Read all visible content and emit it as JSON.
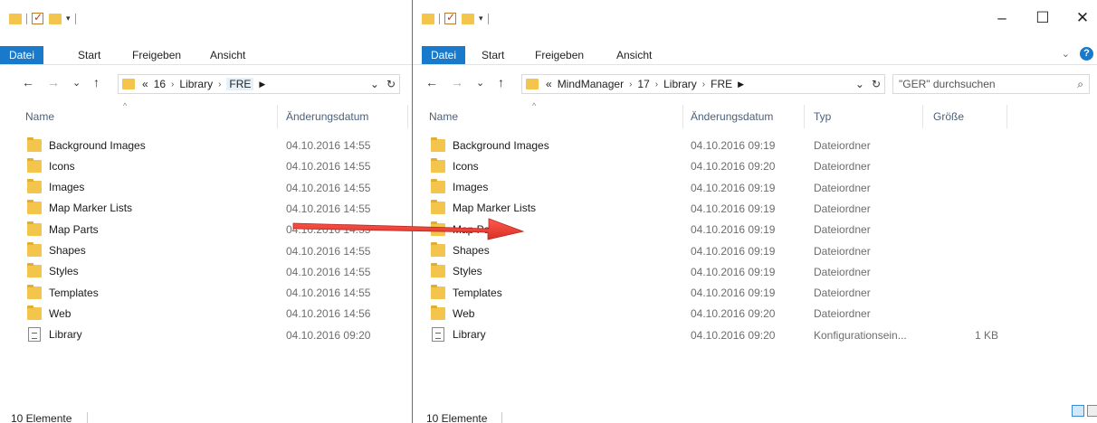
{
  "left": {
    "tabs": [
      "Datei",
      "Start",
      "Freigeben",
      "Ansicht"
    ],
    "breadcrumbs": [
      "«",
      "16",
      "Library",
      "FRE"
    ],
    "columns": [
      "Name",
      "Änderungsdatum"
    ],
    "rows": [
      {
        "name": "Background Images",
        "date": "04.10.2016 14:55"
      },
      {
        "name": "Icons",
        "date": "04.10.2016 14:55"
      },
      {
        "name": "Images",
        "date": "04.10.2016 14:55"
      },
      {
        "name": "Map Marker Lists",
        "date": "04.10.2016 14:55"
      },
      {
        "name": "Map Parts",
        "date": "04.10.2016 14:55"
      },
      {
        "name": "Shapes",
        "date": "04.10.2016 14:55"
      },
      {
        "name": "Styles",
        "date": "04.10.2016 14:55"
      },
      {
        "name": "Templates",
        "date": "04.10.2016 14:55"
      },
      {
        "name": "Web",
        "date": "04.10.2016 14:56"
      },
      {
        "name": "Library",
        "date": "04.10.2016 09:20"
      }
    ],
    "status": "10 Elemente"
  },
  "right": {
    "tabs": [
      "Datei",
      "Start",
      "Freigeben",
      "Ansicht"
    ],
    "breadcrumbs": [
      "«",
      "MindManager",
      "17",
      "Library",
      "FRE"
    ],
    "search_placeholder": "\"GER\" durchsuchen",
    "columns": [
      "Name",
      "Änderungsdatum",
      "Typ",
      "Größe"
    ],
    "rows": [
      {
        "name": "Background Images",
        "date": "04.10.2016 09:19",
        "type": "Dateiordner",
        "size": ""
      },
      {
        "name": "Icons",
        "date": "04.10.2016 09:20",
        "type": "Dateiordner",
        "size": ""
      },
      {
        "name": "Images",
        "date": "04.10.2016 09:19",
        "type": "Dateiordner",
        "size": ""
      },
      {
        "name": "Map Marker Lists",
        "date": "04.10.2016 09:19",
        "type": "Dateiordner",
        "size": ""
      },
      {
        "name": "Map Parts",
        "date": "04.10.2016 09:19",
        "type": "Dateiordner",
        "size": ""
      },
      {
        "name": "Shapes",
        "date": "04.10.2016 09:19",
        "type": "Dateiordner",
        "size": ""
      },
      {
        "name": "Styles",
        "date": "04.10.2016 09:19",
        "type": "Dateiordner",
        "size": ""
      },
      {
        "name": "Templates",
        "date": "04.10.2016 09:19",
        "type": "Dateiordner",
        "size": ""
      },
      {
        "name": "Web",
        "date": "04.10.2016 09:20",
        "type": "Dateiordner",
        "size": ""
      },
      {
        "name": "Library",
        "date": "04.10.2016 09:20",
        "type": "Konfigurationsein...",
        "size": "1 KB"
      }
    ],
    "status": "10 Elemente"
  },
  "icons": {
    "folder": "folder-icon",
    "file": "config-file-icon",
    "minimize": "–",
    "maximize": "☐",
    "close": "✕",
    "back": "←",
    "forward": "→",
    "up": "↑",
    "recent": "⌄",
    "refresh": "↻",
    "search": "⚲"
  },
  "colors": {
    "accent": "#1979ca",
    "folder": "#f4c54c",
    "arrow": "#e53935"
  }
}
